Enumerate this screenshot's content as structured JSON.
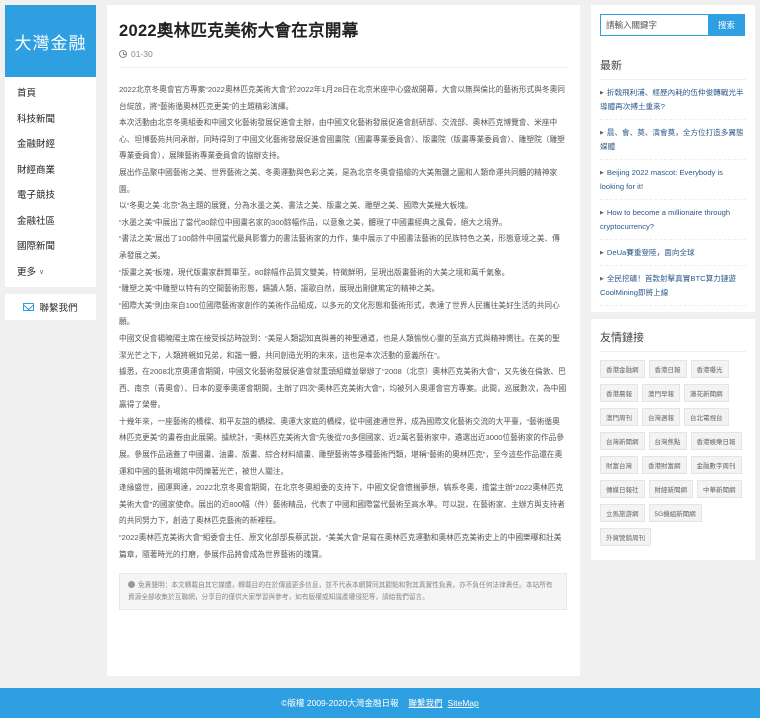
{
  "logo": "大灣金融",
  "nav": [
    "首頁",
    "科技新聞",
    "金融財經",
    "財經商業",
    "電子競技",
    "金融社區",
    "國際新聞"
  ],
  "nav_more": "更多",
  "contact": "聯繫我們",
  "article": {
    "title": "2022奧林匹克美術大會在京開幕",
    "date": "01-30",
    "paragraphs": [
      "2022北京冬奧會官方專案“2022奧林匹克美術大會”於2022年1月28日在北京米座中心盛故開幕，大會以無與倫比的藝術形式與冬奧同台綻放，將“藝術循奧林匹克更美”的主題精彩演繹。",
      "本次活動由北京冬奧組委和中國文化藝術發展促進會主辦，由中國文化藝術發展促進會創研部、交流部、奧林匹克博覽會、米座中心、坦博藝苑共同承辦，同時得到了中國文化藝術發展促進會國畫院（國畫專業委員會）、版畫院（版畫專業委員會）、雕塑院（雕塑專業委員會），展陳藝術專業委員會的協辦支持。",
      "展出作品聚中國藝術之美、世界藝術之美、冬奧運動與色彩之美，是為北京冬奧會描繪的大美無疆之圖和人類命運共同體的精神家園。",
      "以“冬奧之美·北京”為主題的展覽，分為水墨之美、書法之美、版畫之美、雕塑之美、國際大美幾大板塊。",
      "“水墨之美”中展出了當代80餘位中國畫名家的300餘幅作品，以意象之美，體現了中國畫經典之風骨，絕大之境界。",
      "“書法之美”展出了100餘件中國當代最具影響力的書法藝術家的力作，集中展示了中國書法藝術的民族特色之美，形態意境之美、傳承發展之美。",
      "“版畫之美”板塊，現代版畫家群賢畢至，80餘幅作品質文雙美，特徵鮮明，呈現出版畫藝術的大美之境和萬千氣象。",
      "“雕塑之美”中雕塑以特有的空間藝術形態，鑄讀人類，謳歌自然，展現出剛健篤定的精神之美。",
      "“國際大美”則由來自100位國際藝術家創作的美術作品組成，以多元的文化形態和藝術形式，表達了世界人民攜往美好生活的共同心願。",
      "中國文促會楊曉陽主席在接受採訪時說到：“美是人類認知真與善的神聖通道，也是人類愉悅心靈的至高方式與精神嚮往。在美的聖潔光芒之下，人類將親如兄弟，和諧一體，共同創造光明的未來，這也是本次活動的意義所在”。",
      "據悉，在2008北京奧運會期間，中國文化藝術發展促進會就重頭組織並舉辦了“2008（北京）奧林匹克美術大會”，又先後在倫敦、巴西、南京（青奧會）、日本的夏季奧運會期間，主辦了四次“奧林匹克美術大會”，均被列入奧運會官方專案。此間，巡展數次，為中國贏得了榮譽。",
      "十幾年來，一座藝術的橋樑、和平友誼的橋樑、奧運大家庭的橋樑，從中國連通世界，成為國際文化藝術交流的大平臺，“藝術循奧林匹克更美”的畫卷由此展開。據統計，“奧林匹克美術大會”先後從70多個國家、近2萬名藝術家中，遴選出近3000位藝術家的作品參展。參展作品涵蓋了中國畫、油畫、版畫、綜合材料繪畫、雕塑藝術等多種藝術門類，堪稱“藝術的奧林匹克”，至今這些作品還在奧運和中國的藝術場館中閃爍著光芒，被世人關注。",
      "逢緣盛世，國運興達，2022北京冬奧會期間，在北京冬奧組委的支持下，中國文促會懷揣夢想，犒系冬奧，擔當主辦“2022奧林匹克美術大會”的國家使命。展出的近800幅（件）藝術精品，代表了中國和國際當代藝術至高水準。可以說，在藝術家、主辦方與支持者的共同努力下，創造了奧林匹克藝術的新裡程。",
      "“2022奧林匹克美術大會”組委會主任、原文化部部長蔡武說，“美美大會”是寫在奧林匹克運動和奧林匹克美術史上的中國樂曝和壯美篇章，隨著時光的打磨，參展作品將會成為世界藝術的瑰寶。"
    ],
    "disclaimer": "免責聲明：本文轉載自其它媒體，轉載目的在於傳遞更多信息，並不代表本網贊同其觀點和對其真實性負責，亦不負任何法律責任。本站所有資源全部收集於互聯網，分享目的僅供大家學習與參考，如有版權或知識產權侵犯等，請給我們留言。"
  },
  "search": {
    "placeholder": "請輸入關鍵字",
    "button": "搜索"
  },
  "latest": {
    "title": "最新",
    "items": [
      "折戟飛利浦、經歷內耗的伍仲俊轉戰光半導體再次搏土重來?",
      "晨、會、莫、演會莫，全方位打造多翼態媒體",
      "Beijing 2022 mascot: Everybody is looking for it!",
      "How to become a millionaire through cryptocurrency?",
      "DeUa賽重登陸，面向全球",
      "全民挖礦！首款射擊真實BTC算力鏈遊CoolMining即將上線"
    ]
  },
  "links": {
    "title": "友情鏈接",
    "tags": [
      "香港金融網",
      "香港日報",
      "香港曝光",
      "香港晨報",
      "澳門早報",
      "蓮花新聞網",
      "澳門周刊",
      "台灣週報",
      "台北電視台",
      "台灣新聞網",
      "台灣焦點",
      "香港娛樂日報",
      "財富台灣",
      "香港財富網",
      "金融數字周刊",
      "傳媒日報社",
      "財經新聞網",
      "中華新聞網",
      "立馬旅游網",
      "5G機組新聞網",
      "外貿營銷周刊"
    ]
  },
  "footer": {
    "copyright": "©版權 2009-2020大灣金融日報",
    "contact": "聯繫我們",
    "sitemap": "SiteMap"
  }
}
